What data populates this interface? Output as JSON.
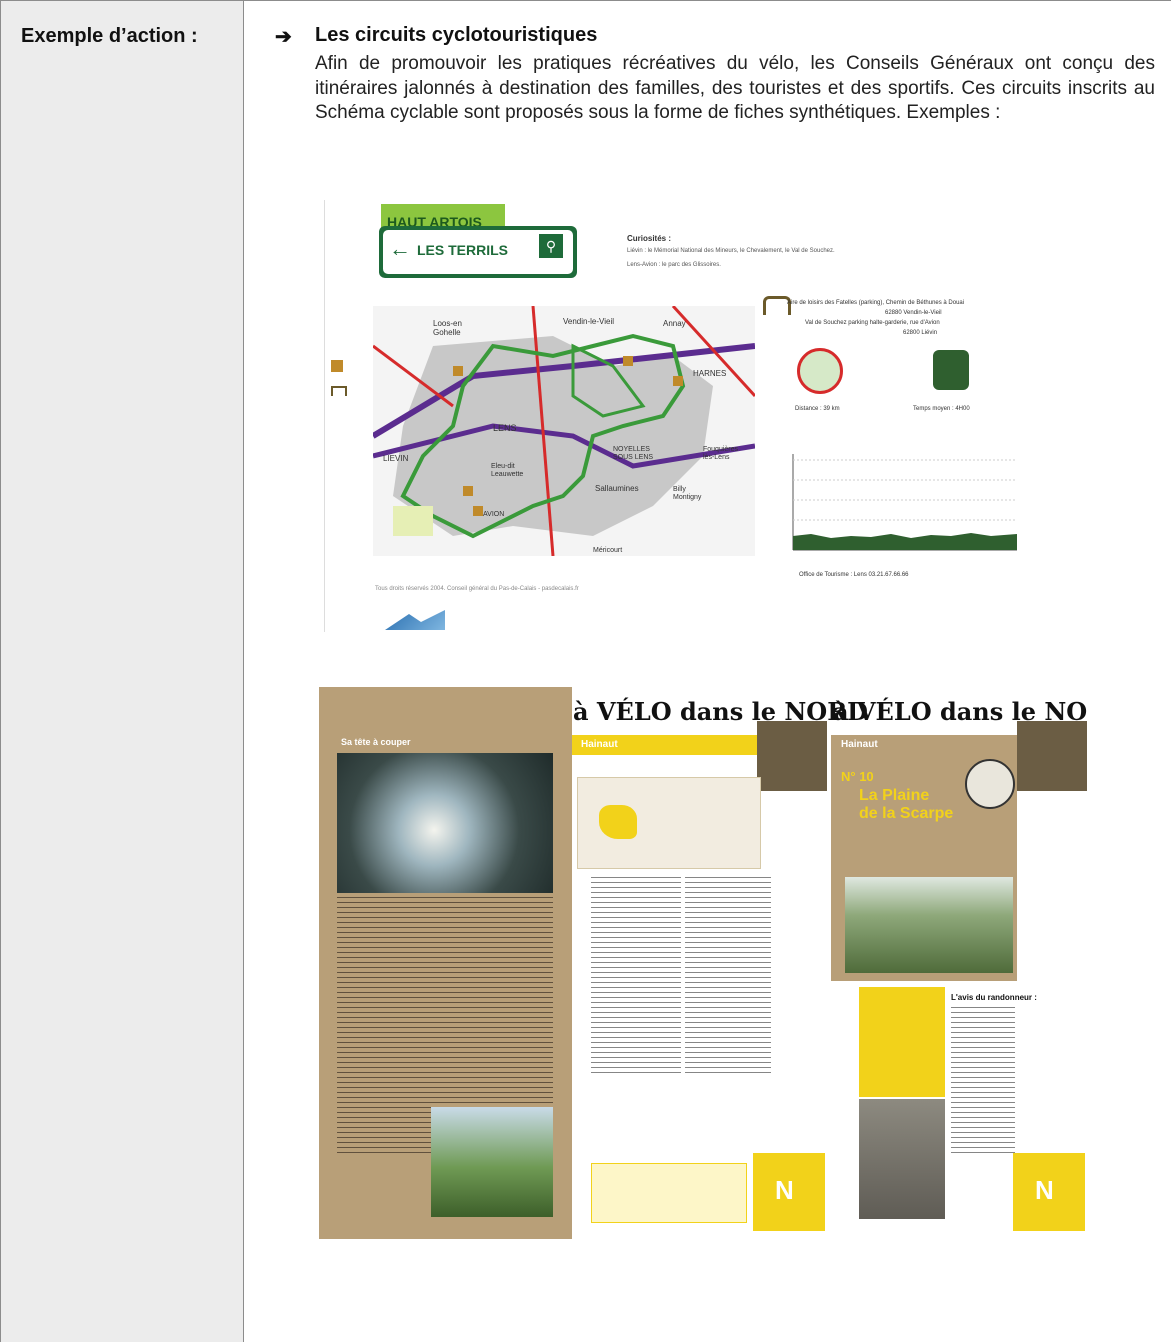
{
  "row": {
    "label": "Exemple d’action :",
    "arrow": "➔",
    "heading": "Les circuits cyclotouristiques",
    "paragraph": "Afin de promouvoir les pratiques récréatives du vélo, les Conseils Généraux ont conçu des itinéraires jalonnés à destination des familles, des touristes et des sportifs. Ces circuits inscrits au Schéma cyclable sont proposés sous la forme de fiches synthétiques. Exemples :"
  },
  "sheet1": {
    "region": "HAUT ARTOIS",
    "sign": "LES TERRILS",
    "curiosites_title": "Curiosités :",
    "curiosites_1": "Liévin : le Mémorial National des Mineurs, le Chevalement, le Val de Souchez.",
    "curiosites_2": "Lens-Avion : le parc des Glissoires.",
    "parking_1": "Aire de loisirs des Fatelles (parking), Chemin de Béthunes à Douai",
    "parking_2": "62880 Vendin-le-Vieil",
    "parking_3": "Val de Souchez parking halte-garderie, rue d'Avion",
    "parking_4": "62800 Liévin",
    "distance": "Distance : 39 km",
    "temps": "Temps moyen : 4H00",
    "office": "Office de Tourisme : Lens 03.21.67.66.66",
    "copyright": "Tous droits réservés 2004. Conseil général du Pas-de-Calais - pasdecalais.fr",
    "map_labels": [
      "Loos-en Gohelle",
      "Vendin-le-Vieil",
      "Annay",
      "LENS",
      "HARNES",
      "LIEVIN",
      "Eleu-dit Leauwette",
      "Sallaumines",
      "Billy Montigny",
      "Fouquières lès-Lens",
      "NOYELLES SOUS LENS",
      "AVION",
      "Méricourt",
      "Liévin"
    ],
    "colors": {
      "green_route": "#3a9a3a",
      "purple_road": "#5b2c8f",
      "red_road": "#d62b2b",
      "map_gray": "#c8c8c8",
      "header_green": "#8cc63f"
    }
  },
  "sheet2": {
    "left_title": "Sa tête à couper",
    "banner_1": "à VÉLO dans le NORD",
    "banner_2": "à VÉLO dans le NORD",
    "hainaut_1": "Hainaut",
    "hainaut_2": "Hainaut",
    "number": "N° 10",
    "route_title_1": "La Plaine",
    "route_title_2": "de la Scarpe",
    "avis_title": "L'avis du randonneur :",
    "colors": {
      "tan": "#b89f78",
      "yellow": "#f2d21a",
      "dark_text": "#2b2b2b"
    }
  }
}
